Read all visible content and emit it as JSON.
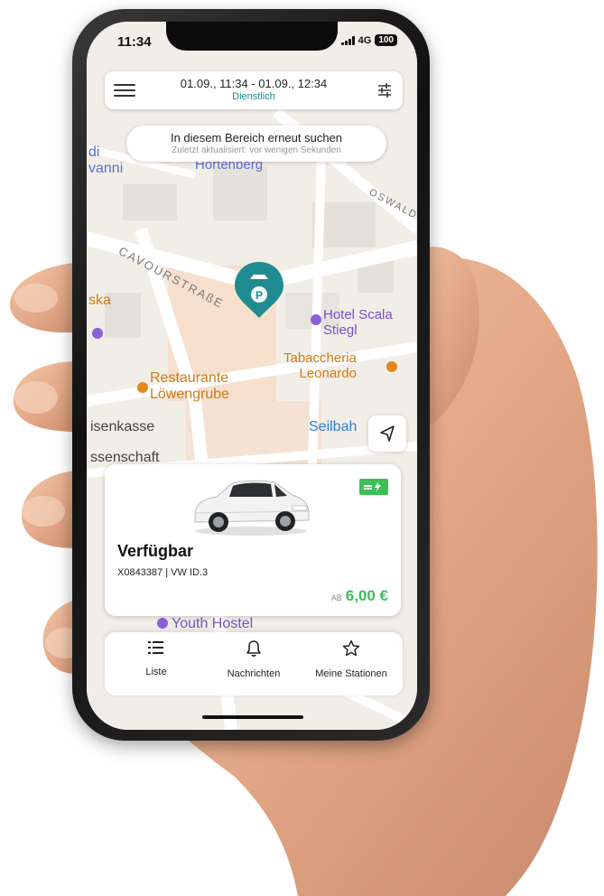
{
  "status_bar": {
    "time": "11:34",
    "network": "4G",
    "battery": "100"
  },
  "top_bar": {
    "date_range": "01.09., 11:34 - 01.09., 12:34",
    "trip_type": "Dienstlich"
  },
  "search_area": {
    "title": "In diesem Bereich erneut suchen",
    "subtitle": "Zuletzt aktualisiert: vor wenigen Sekunden"
  },
  "map": {
    "labels": {
      "hotel": "Hotel Scala\nStiegl",
      "tabaccheria": "Tabaccheria\nLeonardo",
      "restaurant": "Restaurante\nLöwengrube",
      "street_cavour": "CAVOURSTRAßE",
      "street_oswald": "OSWALD",
      "hortenberg": "Hortenberg",
      "seilbahn": "Seilbah",
      "sparkasse": "isenkasse",
      "wissenschaft": "ssenschaft",
      "youth_hostel": "Youth Hostel",
      "vanni": "vanni",
      "di": "di",
      "ska": "ska"
    },
    "colors": {
      "parking_pin": "#1f8c92",
      "poi_purple": "#8a5fd6",
      "poi_orange": "#e3891c",
      "poi_blue": "#2f7ed8"
    }
  },
  "car_card": {
    "status": "Verfügbar",
    "plate_model": "X0843387 | VW ID.3",
    "price_prefix": "AB",
    "price": "6,00 €",
    "accent": "#3dbf58"
  },
  "bottom_nav": [
    {
      "label": "Liste",
      "icon": "list-icon"
    },
    {
      "label": "Nachrichten",
      "icon": "bell-icon"
    },
    {
      "label": "Meine Stationen",
      "icon": "star-icon"
    }
  ]
}
